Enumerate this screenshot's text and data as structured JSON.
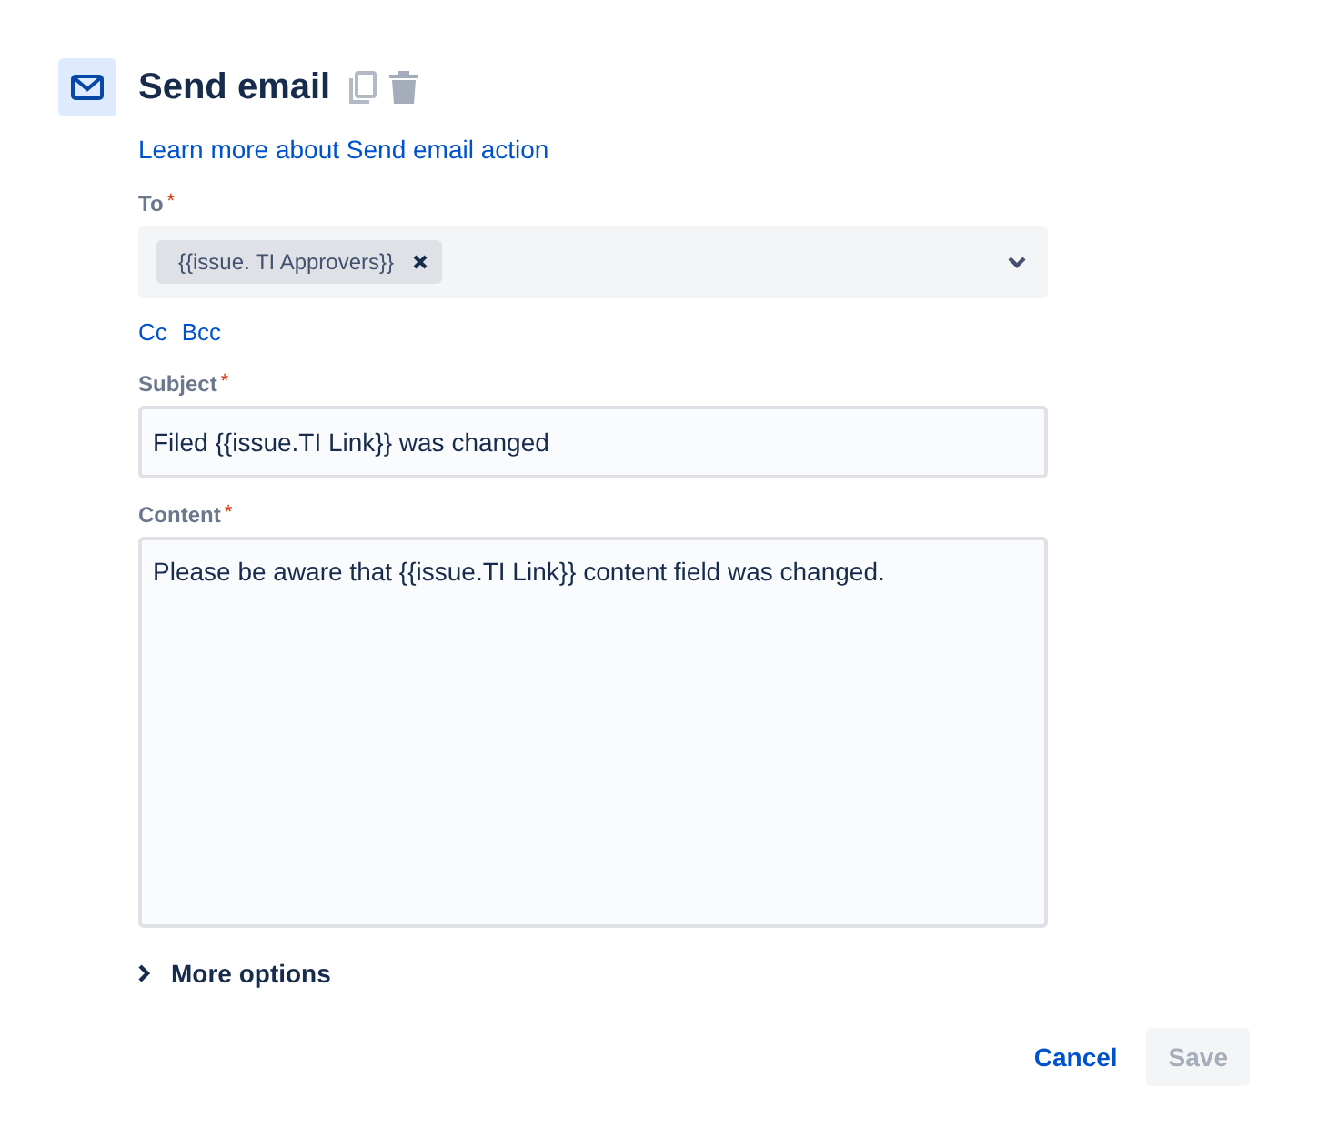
{
  "header": {
    "title": "Send email",
    "help_link": "Learn more about Send email action"
  },
  "to": {
    "label": "To",
    "required_mark": "*",
    "chips": [
      {
        "label": "{{issue. TI Approvers}}"
      }
    ]
  },
  "recipient_links": [
    "Cc",
    "Bcc"
  ],
  "subject": {
    "label": "Subject",
    "required_mark": "*",
    "value": "Filed {{issue.TI Link}} was changed"
  },
  "content": {
    "label": "Content",
    "required_mark": "*",
    "value": "Please be aware that {{issue.TI Link}} content field was changed."
  },
  "more_options": {
    "label": "More options",
    "expanded": false
  },
  "buttons": [
    {
      "label": "Cancel",
      "kind": "link",
      "disabled": false
    },
    {
      "label": "Save",
      "kind": "primary",
      "disabled": true
    }
  ]
}
